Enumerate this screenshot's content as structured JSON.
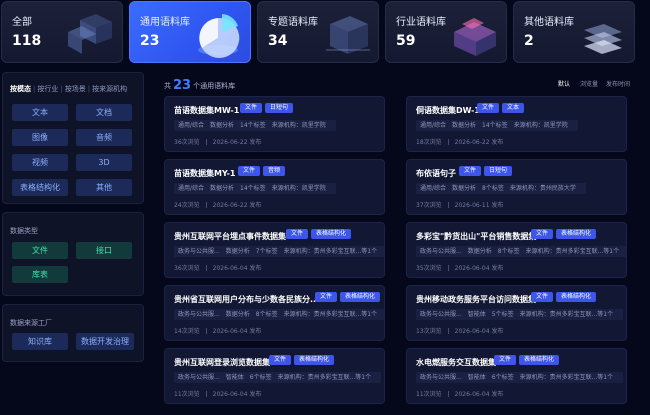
{
  "stats": [
    {
      "label": "全部",
      "count": "118"
    },
    {
      "label": "通用语料库",
      "count": "23"
    },
    {
      "label": "专题语料库",
      "count": "34"
    },
    {
      "label": "行业语料库",
      "count": "59"
    },
    {
      "label": "其他语料库",
      "count": "2"
    }
  ],
  "filter_tabs": [
    "按模态",
    "按行业",
    "按场景",
    "按来源机构"
  ],
  "modality": [
    "文本",
    "文档",
    "图像",
    "音频",
    "视频",
    "3D",
    "表格结构化",
    "其他"
  ],
  "data_type": {
    "title": "数据类型",
    "items": [
      "文件",
      "接口",
      "库表"
    ]
  },
  "source": {
    "title": "数据来源工厂",
    "items": [
      "知识库",
      "数据开发治理"
    ]
  },
  "list_header": {
    "prefix": "共",
    "count": "23",
    "suffix": "个通用语料库"
  },
  "sort_options": [
    "默认",
    "浏览量",
    "发布时间"
  ],
  "datasets": [
    {
      "title": "苗语数据集MW-1",
      "badges": [
        "文件",
        "日短句"
      ],
      "meta": [
        "通用/综合",
        "数据分析",
        "14个标签",
        "来源机构：凯里学院"
      ],
      "views": "36次浏览",
      "date": "2026-06-22 发布"
    },
    {
      "title": "侗语数据集DW-1",
      "badges": [
        "文件",
        "文本"
      ],
      "meta": [
        "通用/综合",
        "数据分析",
        "14个标签",
        "来源机构：凯里学院"
      ],
      "views": "18次浏览",
      "date": "2026-06-22 发布"
    },
    {
      "title": "苗语数据集MY-1",
      "badges": [
        "文件",
        "音频"
      ],
      "meta": [
        "通用/综合",
        "数据分析",
        "14个标签",
        "来源机构：凯里学院"
      ],
      "views": "24次浏览",
      "date": "2026-06-22 发布"
    },
    {
      "title": "布依语句子",
      "badges": [
        "文件",
        "日短句"
      ],
      "meta": [
        "通用/综合",
        "数据分析",
        "8个标签",
        "来源机构：贵州民族大学"
      ],
      "views": "37次浏览",
      "date": "2026-06-11 发布"
    },
    {
      "title": "贵州互联网平台埋点事件数据集",
      "badges": [
        "文件",
        "表格结构化"
      ],
      "meta": [
        "政务与公共服...",
        "数据分析",
        "7个标签",
        "来源机构：贵州多彩宝互联...等1个"
      ],
      "views": "36次浏览",
      "date": "2026-06-04 发布"
    },
    {
      "title": "多彩宝\"黔货出山\"平台销售数据集",
      "badges": [
        "文件",
        "表格结构化"
      ],
      "meta": [
        "政务与公共服...",
        "数据分析",
        "8个标签",
        "来源机构：贵州多彩宝互联...等1个"
      ],
      "views": "35次浏览",
      "date": "2026-06-04 发布"
    },
    {
      "title": "贵州省互联网用户分布与少数各民族分...",
      "badges": [
        "文件",
        "表格结构化"
      ],
      "meta": [
        "政务与公共服...",
        "数据分析",
        "8个标签",
        "来源机构：贵州多彩宝互联...等1个"
      ],
      "views": "14次浏览",
      "date": "2026-06-04 发布"
    },
    {
      "title": "贵州移动政务服务平台访问数据集",
      "badges": [
        "文件",
        "表格结构化"
      ],
      "meta": [
        "政务与公共服...",
        "智能体",
        "5个标签",
        "来源机构：贵州多彩宝互联...等1个"
      ],
      "views": "13次浏览",
      "date": "2026-06-04 发布"
    },
    {
      "title": "贵州互联网登录浏览数据集",
      "badges": [
        "文件",
        "表格结构化"
      ],
      "meta": [
        "政务与公共服...",
        "智能体",
        "6个标签",
        "来源机构：贵州多彩宝互联...等1个"
      ],
      "views": "11次浏览",
      "date": "2026-06-04 发布"
    },
    {
      "title": "水电燃服务交互数据集",
      "badges": [
        "文件",
        "表格结构化"
      ],
      "meta": [
        "政务与公共服...",
        "智能体",
        "6个标签",
        "来源机构：贵州多彩宝互联...等1个"
      ],
      "views": "11次浏览",
      "date": "2026-06-04 发布"
    }
  ],
  "colors": {
    "background": "#05081a",
    "accent": "#3f7bff",
    "card": "#121734",
    "green": "#44e0b0"
  }
}
